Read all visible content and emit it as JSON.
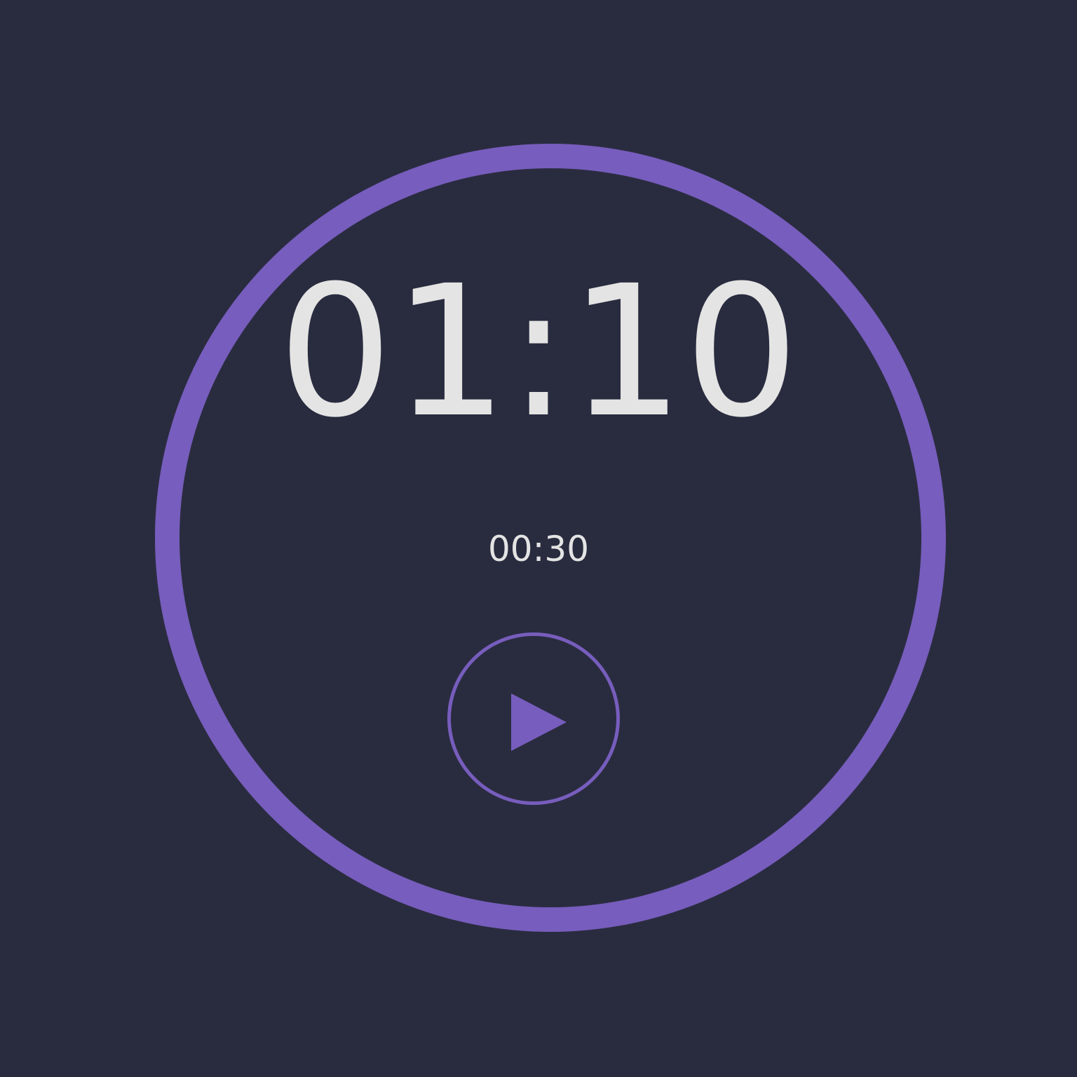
{
  "timer": {
    "main_time": "01:10",
    "sub_time": "00:30"
  },
  "controls": {
    "play_icon": "play-icon"
  },
  "colors": {
    "background": "#292c3f",
    "accent": "#775dbd",
    "text": "#e4e4e4"
  }
}
